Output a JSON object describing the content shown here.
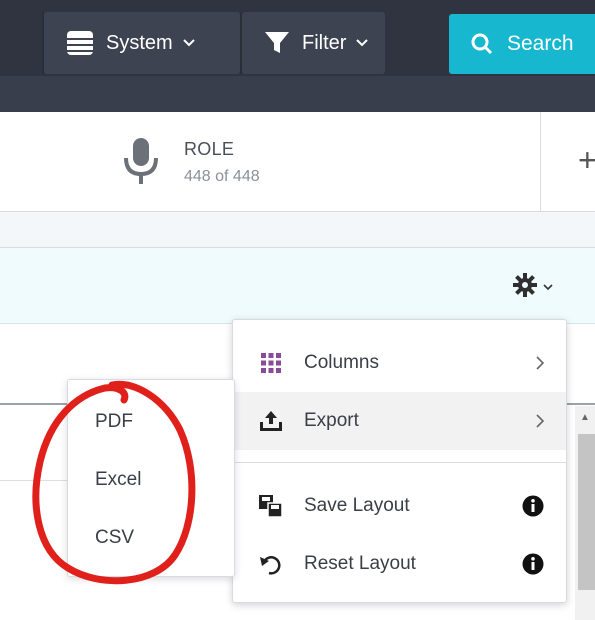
{
  "toolbar": {
    "system_label": "System",
    "filter_label": "Filter",
    "search_label": "Search"
  },
  "summary": {
    "role_label": "ROLE",
    "role_count": "448 of 448",
    "add_symbol": "+"
  },
  "menu": {
    "items": [
      {
        "label": "Columns",
        "icon": "grid-dots-icon",
        "right": "chevron-right-icon"
      },
      {
        "label": "Export",
        "icon": "upload-tray-icon",
        "right": "chevron-right-icon"
      },
      {
        "label": "Save Layout",
        "icon": "save-layout-icon",
        "right": "info-icon"
      },
      {
        "label": "Reset Layout",
        "icon": "undo-icon",
        "right": "info-icon"
      }
    ]
  },
  "export_submenu": {
    "items": [
      "PDF",
      "Excel",
      "CSV"
    ]
  },
  "colors": {
    "toolbar_bg": "#2f3440",
    "search_accent": "#17b7cf",
    "annotation": "#e0211b",
    "highlight_band": "#effbfd"
  }
}
